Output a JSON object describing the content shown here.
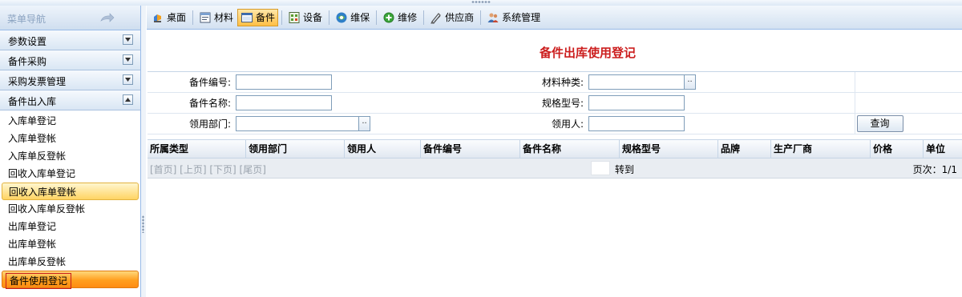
{
  "sidebar": {
    "title": "菜单导航",
    "sections": [
      {
        "label": "参数设置"
      },
      {
        "label": "备件采购"
      },
      {
        "label": "采购发票管理"
      },
      {
        "label": "备件出入库"
      }
    ],
    "items": [
      {
        "label": "入库单登记"
      },
      {
        "label": "入库单登帐"
      },
      {
        "label": "入库单反登帐"
      },
      {
        "label": "回收入库单登记"
      },
      {
        "label": "回收入库单登帐"
      },
      {
        "label": "回收入库单反登帐"
      },
      {
        "label": "出库单登记"
      },
      {
        "label": "出库单登帐"
      },
      {
        "label": "出库单反登帐"
      },
      {
        "label": "备件使用登记"
      }
    ]
  },
  "toolbar": {
    "buttons": [
      {
        "label": "桌面",
        "icon": "desktop-icon"
      },
      {
        "label": "材料",
        "icon": "material-icon"
      },
      {
        "label": "备件",
        "icon": "spare-parts-icon",
        "selected": true
      },
      {
        "label": "设备",
        "icon": "equipment-icon"
      },
      {
        "label": "维保",
        "icon": "maintenance-icon"
      },
      {
        "label": "维修",
        "icon": "repair-icon"
      },
      {
        "label": "供应商",
        "icon": "supplier-icon"
      },
      {
        "label": "系统管理",
        "icon": "system-admin-icon"
      }
    ]
  },
  "page": {
    "title": "备件出库使用登记"
  },
  "form": {
    "part_no_label": "备件编号:",
    "part_name_label": "备件名称:",
    "dept_label": "领用部门:",
    "material_type_label": "材料种类:",
    "spec_label": "规格型号:",
    "receiver_label": "领用人:",
    "picker_label": "..",
    "query_button": "查询"
  },
  "grid": {
    "columns": [
      "所属类型",
      "领用部门",
      "领用人",
      "备件编号",
      "备件名称",
      "规格型号",
      "品牌",
      "生产厂商",
      "价格",
      "单位"
    ]
  },
  "pager": {
    "links": "[首页] [上页] [下页] [尾页]",
    "goto": "转到",
    "page_info": "页次：1/1"
  },
  "colors": {
    "title_red": "#cc1e1e",
    "active_orange": "#ff9f1f",
    "border_blue": "#99bbe8"
  }
}
